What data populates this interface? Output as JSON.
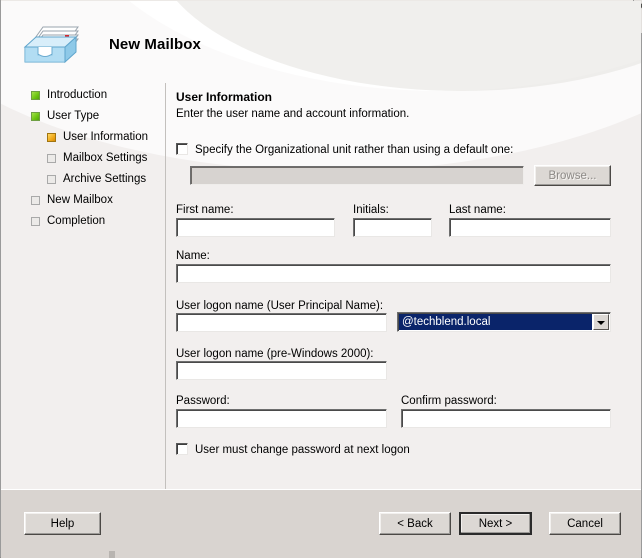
{
  "window": {
    "title": "New Mailbox",
    "icon": "mailbox-tray-icon"
  },
  "sidebar": {
    "items": [
      {
        "label": "Introduction",
        "state": "done",
        "level": 0,
        "name": "introduction"
      },
      {
        "label": "User Type",
        "state": "done",
        "level": 0,
        "name": "user-type"
      },
      {
        "label": "User Information",
        "state": "current",
        "level": 1,
        "name": "user-information"
      },
      {
        "label": "Mailbox Settings",
        "state": "pending",
        "level": 1,
        "name": "mailbox-settings"
      },
      {
        "label": "Archive Settings",
        "state": "pending",
        "level": 1,
        "name": "archive-settings"
      },
      {
        "label": "New Mailbox",
        "state": "pending",
        "level": 0,
        "name": "new-mailbox"
      },
      {
        "label": "Completion",
        "state": "pending",
        "level": 0,
        "name": "completion"
      }
    ]
  },
  "page": {
    "title": "User Information",
    "subtitle": "Enter the user name and account information."
  },
  "form": {
    "ou_checkbox_label": "Specify the Organizational unit rather than using a default one:",
    "ou_checkbox_checked": false,
    "ou_value": "",
    "browse_label": "Browse...",
    "browse_enabled": false,
    "first_name_label": "First name:",
    "first_name_value": "",
    "initials_label": "Initials:",
    "initials_value": "",
    "last_name_label": "Last name:",
    "last_name_value": "",
    "name_label": "Name:",
    "name_value": "",
    "upn_label": "User logon name (User Principal Name):",
    "upn_value": "",
    "upn_domain_selected": "@techblend.local",
    "upn_domain_options": [
      "@techblend.local"
    ],
    "pre2000_label": "User logon name (pre-Windows 2000):",
    "pre2000_value": "",
    "password_label": "Password:",
    "password_value": "",
    "confirm_password_label": "Confirm password:",
    "confirm_password_value": "",
    "must_change_label": "User must change password at next logon",
    "must_change_checked": false
  },
  "footer": {
    "help_label": "Help",
    "back_label": "< Back",
    "next_label": "Next >",
    "cancel_label": "Cancel"
  },
  "colors": {
    "selection_blue": "#0a246a",
    "step_done_green": "#6dc412",
    "step_current_amber": "#f0a91b",
    "dialog_face": "#d9d4d0",
    "panel_face": "#f2efee"
  }
}
